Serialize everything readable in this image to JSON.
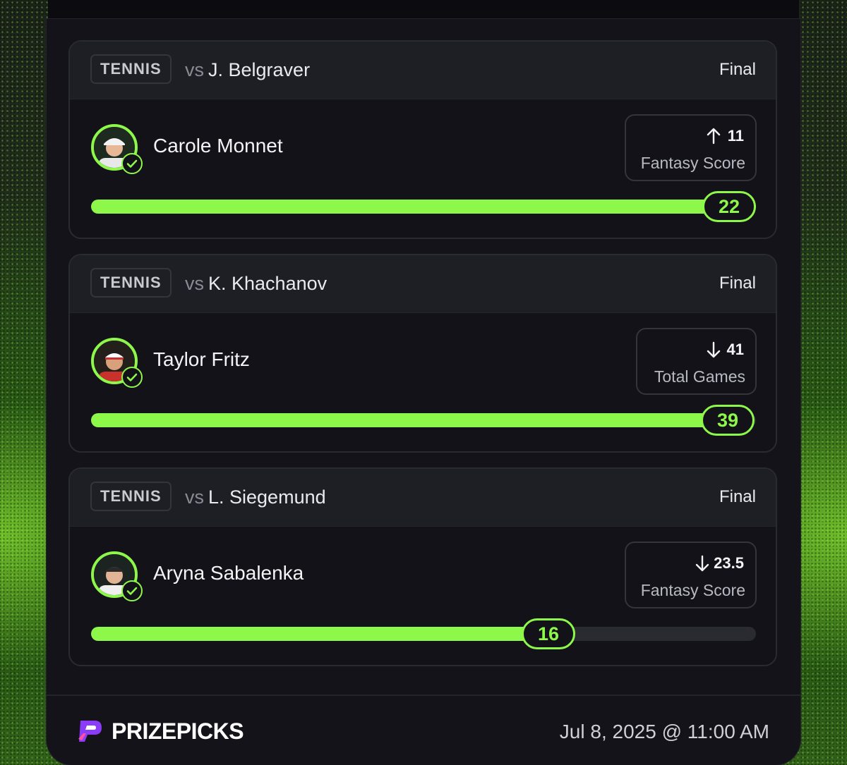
{
  "picks": [
    {
      "sport": "TENNIS",
      "vs_prefix": "vs",
      "opponent": "J. Belgraver",
      "status": "Final",
      "player": "Carole Monnet",
      "direction": "up",
      "line": "11",
      "stat": "Fantasy Score",
      "result": "22",
      "progress": 1.0
    },
    {
      "sport": "TENNIS",
      "vs_prefix": "vs",
      "opponent": "K. Khachanov",
      "status": "Final",
      "player": "Taylor Fritz",
      "direction": "down",
      "line": "41",
      "stat": "Total Games",
      "result": "39",
      "progress": 0.951
    },
    {
      "sport": "TENNIS",
      "vs_prefix": "vs",
      "opponent": "L. Siegemund",
      "status": "Final",
      "player": "Aryna Sabalenka",
      "direction": "down",
      "line": "23.5",
      "stat": "Fantasy Score",
      "result": "16",
      "progress": 0.681
    }
  ],
  "footer": {
    "brand": "PRIZEPICKS",
    "datetime": "Jul 8, 2025 @ 11:00 AM"
  },
  "colors": {
    "accent": "#8df74a",
    "panel": "#131319",
    "logo": "#8b3cf7"
  }
}
